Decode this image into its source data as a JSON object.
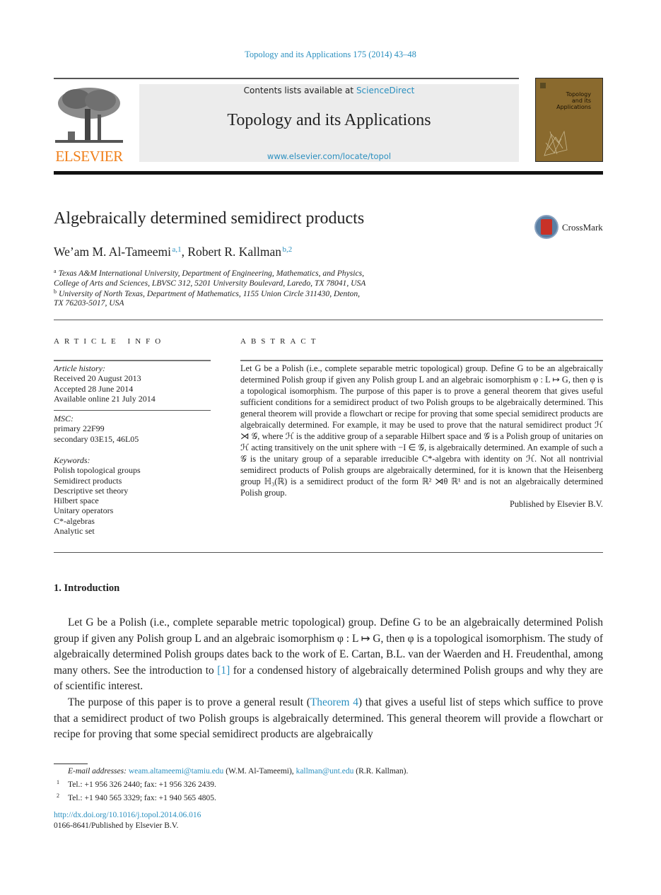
{
  "journal_ref": "Topology and its Applications 175 (2014) 43–48",
  "banner": {
    "contents_prefix": "Contents lists available at ",
    "contents_link": "ScienceDirect",
    "journal_title": "Topology and its Applications",
    "url": "www.elsevier.com/locate/topol"
  },
  "publisher_logo": "ELSEVIER",
  "cover": {
    "line1": "Topology",
    "line2": "and its",
    "line3": "Applications"
  },
  "crossmark_label": "CrossMark",
  "article_title": "Algebraically determined semidirect products",
  "authors": [
    {
      "name": "We’am M. Al-Tameemi",
      "marks": "a,1"
    },
    {
      "name": "Robert R. Kallman",
      "marks": "b,2"
    }
  ],
  "affiliations": [
    {
      "mark": "a",
      "line1": "Texas A&M International University, Department of Engineering, Mathematics, and Physics,",
      "line2": "College of Arts and Sciences, LBVSC 312, 5201 University Boulevard, Laredo, TX 78041, USA"
    },
    {
      "mark": "b",
      "line1": "University of North Texas, Department of Mathematics, 1155 Union Circle 311430, Denton,",
      "line2": "TX 76203-5017, USA"
    }
  ],
  "article_info": {
    "heading": "ARTICLE INFO",
    "history_label": "Article history:",
    "history": [
      "Received 20 August 2013",
      "Accepted 28 June 2014",
      "Available online 21 July 2014"
    ],
    "msc_label": "MSC:",
    "msc": [
      "primary 22F99",
      "secondary 03E15, 46L05"
    ],
    "keywords_label": "Keywords:",
    "keywords": [
      "Polish topological groups",
      "Semidirect products",
      "Descriptive set theory",
      "Hilbert space",
      "Unitary operators",
      "C*-algebras",
      "Analytic set"
    ]
  },
  "abstract": {
    "heading": "ABSTRACT",
    "text": "Let G be a Polish (i.e., complete separable metric topological) group. Define G to be an algebraically determined Polish group if given any Polish group L and an algebraic isomorphism φ : L ↦ G, then φ is a topological isomorphism. The purpose of this paper is to prove a general theorem that gives useful sufficient conditions for a semidirect product of two Polish groups to be algebraically determined. This general theorem will provide a flowchart or recipe for proving that some special semidirect products are algebraically determined. For example, it may be used to prove that the natural semidirect product ℋ ⋊ 𝒢, where ℋ is the additive group of a separable Hilbert space and 𝒢 is a Polish group of unitaries on ℋ acting transitively on the unit sphere with −I ∈ 𝒢, is algebraically determined. An example of such a 𝒢 is the unitary group of a separable irreducible C*-algebra with identity on ℋ. Not all nontrivial semidirect products of Polish groups are algebraically determined, for it is known that the Heisenberg group ℍ₃(ℝ) is a semidirect product of the form ℝ² ⋊θ ℝ¹ and is not an algebraically determined Polish group.",
    "published_by": "Published by Elsevier B.V."
  },
  "introduction": {
    "heading": "1.  Introduction",
    "para1": {
      "before_link": "Let G be a Polish (i.e., complete separable metric topological) group. Define G to be an algebraically determined Polish group if given any Polish group L and an algebraic isomorphism φ : L ↦ G, then φ is a topological isomorphism. The study of algebraically determined Polish groups dates back to the work of E. Cartan, B.L. van der Waerden and H. Freudenthal, among many others. See the introduction to ",
      "link": "[1]",
      "after_link": " for a condensed history of algebraically determined Polish groups and why they are of scientific interest."
    },
    "para2": {
      "before_link": "The purpose of this paper is to prove a general result (",
      "link": "Theorem 4",
      "after_link": ") that gives a useful list of steps which suffice to prove that a semidirect product of two Polish groups is algebraically determined. This general theorem will provide a flowchart or recipe for proving that some special semidirect products are algebraically"
    }
  },
  "footnotes": {
    "email_label": "E-mail addresses:",
    "email1": "weam.altameemi@tamiu.edu",
    "email1_owner": " (W.M. Al-Tameemi), ",
    "email2": "kallman@unt.edu",
    "email2_owner": " (R.R. Kallman).",
    "fn1_mark": "1",
    "fn1": "Tel.: +1 956 326 2440; fax: +1 956 326 2439.",
    "fn2_mark": "2",
    "fn2": "Tel.: +1 940 565 3329; fax: +1 940 565 4805."
  },
  "doi": "http://dx.doi.org/10.1016/j.topol.2014.06.016",
  "issn_line": "0166-8641/Published by Elsevier B.V.",
  "colors": {
    "link": "#2a8fbf",
    "elsevier_orange": "#f07f1a",
    "cover_brown": "#8a6a2e",
    "banner_gray": "#ececec"
  }
}
